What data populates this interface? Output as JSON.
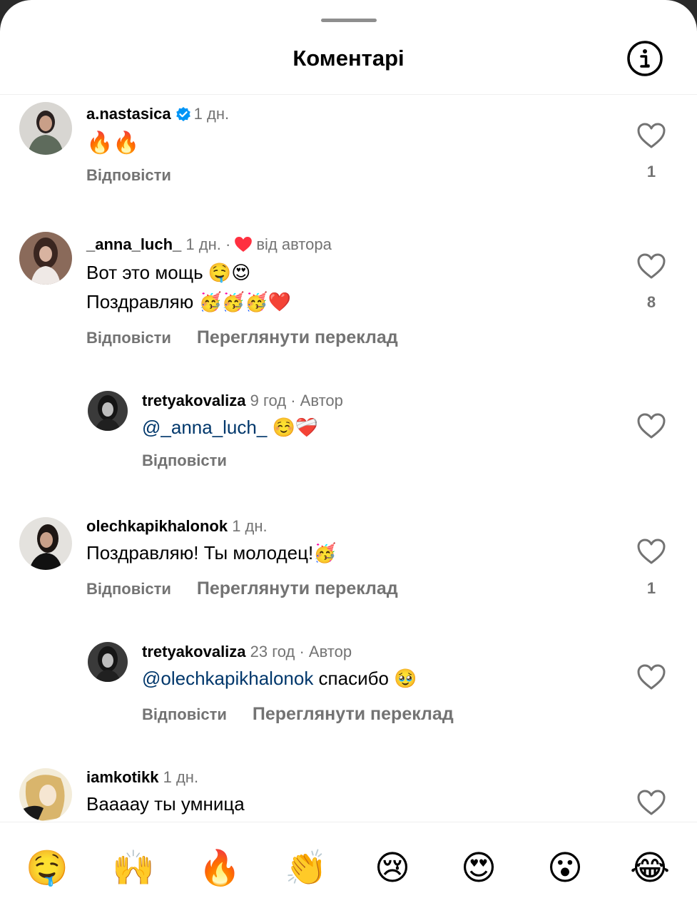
{
  "header": {
    "title": "Коментарі",
    "info_icon": "info-icon"
  },
  "comments": [
    {
      "username": "a.nastasica",
      "verified": true,
      "time": "1 дн.",
      "lines": [
        "🔥🔥"
      ],
      "reply_label": "Відповісти",
      "likes": "1"
    },
    {
      "username": "_anna_luch_",
      "time": "1 дн.",
      "sep": "·",
      "liked_by_author": "від автора",
      "lines": [
        "Вот это мощь 🤤😍",
        "Поздравляю 🥳🥳🥳❤️"
      ],
      "reply_label": "Відповісти",
      "translate_label": "Переглянути переклад",
      "likes": "8"
    },
    {
      "username": "tretyakovaliza",
      "time": "9 год · Автор",
      "mention": "@_anna_luch_",
      "rest": " ☺️❤️‍🩹",
      "reply_label": "Відповісти"
    },
    {
      "username": "olechkapikhalonok",
      "time": "1 дн.",
      "lines": [
        "Поздравляю! Ты молодец!🥳"
      ],
      "reply_label": "Відповісти",
      "translate_label": "Переглянути переклад",
      "likes": "1"
    },
    {
      "username": "tretyakovaliza",
      "time": "23 год · Автор",
      "mention": "@olechkapikhalonok",
      "rest": " спасибо 🥹",
      "reply_label": "Відповісти",
      "translate_label": "Переглянути переклад"
    },
    {
      "username": "iamkotikk",
      "time": "1 дн.",
      "lines": [
        "Ваааау ты умница"
      ]
    }
  ],
  "reactions": [
    "🤤",
    "🙌",
    "🔥",
    "👏",
    "😢",
    "😍",
    "😮",
    "😂"
  ],
  "colors": {
    "mention": "#00376b",
    "secondary_text": "#737373",
    "heart_red": "#ff3040",
    "verified_blue": "#0095f6"
  }
}
